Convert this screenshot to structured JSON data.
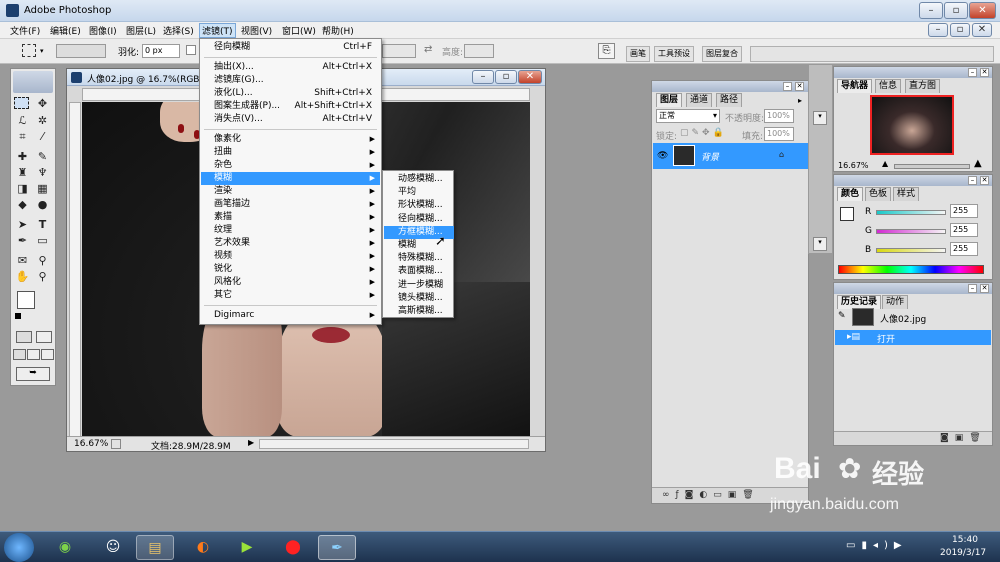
{
  "app": {
    "title": "Adobe Photoshop"
  },
  "menubar": {
    "items": [
      "文件(F)",
      "编辑(E)",
      "图像(I)",
      "图层(L)",
      "选择(S)",
      "滤镜(T)",
      "视图(V)",
      "窗口(W)",
      "帮助(H)"
    ],
    "active": "滤镜(T)"
  },
  "optbar": {
    "feather_label": "羽化:",
    "feather_value": "0 px",
    "height_label": "高度:",
    "dock_tabs": [
      "画笔",
      "工具预设",
      "图层复合"
    ]
  },
  "document": {
    "title": "人像02.jpg @ 16.7%(RGB/8",
    "zoom": "16.67%",
    "doc_size": "文档:28.9M/28.9M"
  },
  "filter_menu": {
    "items": [
      {
        "label": "径向模糊",
        "shortcut": "Ctrl+F"
      },
      {
        "sep": true
      },
      {
        "label": "抽出(X)...",
        "shortcut": "Alt+Ctrl+X"
      },
      {
        "label": "滤镜库(G)...",
        "shortcut": ""
      },
      {
        "label": "液化(L)...",
        "shortcut": "Shift+Ctrl+X"
      },
      {
        "label": "图案生成器(P)...",
        "shortcut": "Alt+Shift+Ctrl+X"
      },
      {
        "label": "消失点(V)...",
        "shortcut": "Alt+Ctrl+V"
      },
      {
        "sep": true
      },
      {
        "label": "像素化",
        "sub": true
      },
      {
        "label": "扭曲",
        "sub": true
      },
      {
        "label": "杂色",
        "sub": true
      },
      {
        "label": "模糊",
        "sub": true,
        "highlighted": true
      },
      {
        "label": "渲染",
        "sub": true
      },
      {
        "label": "画笔描边",
        "sub": true
      },
      {
        "label": "素描",
        "sub": true
      },
      {
        "label": "纹理",
        "sub": true
      },
      {
        "label": "艺术效果",
        "sub": true
      },
      {
        "label": "视频",
        "sub": true
      },
      {
        "label": "锐化",
        "sub": true
      },
      {
        "label": "风格化",
        "sub": true
      },
      {
        "label": "其它",
        "sub": true
      },
      {
        "sep": true
      },
      {
        "label": "Digimarc",
        "sub": true
      }
    ]
  },
  "blur_submenu": {
    "items": [
      "动感模糊...",
      "平均",
      "形状模糊...",
      "径向模糊...",
      "方框模糊...",
      "模糊",
      "特殊模糊...",
      "表面模糊...",
      "进一步模糊",
      "镜头模糊...",
      "高斯模糊..."
    ],
    "highlighted": "方框模糊..."
  },
  "layers_panel": {
    "tabs": [
      "图层",
      "通道",
      "路径"
    ],
    "blend_mode": "正常",
    "opacity_label": "不透明度:",
    "opacity_value": "100%",
    "lock_label": "锁定:",
    "fill_label": "填充:",
    "fill_value": "100%",
    "layer_name": "背景"
  },
  "navigator_panel": {
    "tabs": [
      "导航器",
      "信息",
      "直方图"
    ],
    "zoom": "16.67%"
  },
  "color_panel": {
    "tabs": [
      "颜色",
      "色板",
      "样式"
    ],
    "channels": [
      {
        "label": "R",
        "value": "255",
        "color": "#19c8c8"
      },
      {
        "label": "G",
        "value": "255",
        "color": "#d12bd1"
      },
      {
        "label": "B",
        "value": "255",
        "color": "#d8d80f"
      }
    ]
  },
  "history_panel": {
    "tabs": [
      "历史记录",
      "动作"
    ],
    "snapshot": "人像02.jpg",
    "steps": [
      "打开"
    ]
  },
  "taskbar": {
    "time": "15:40",
    "date": "2019/3/17"
  },
  "watermark": {
    "brand": "Bai",
    "brand2": "经验",
    "url": "jingyan.baidu.com"
  }
}
